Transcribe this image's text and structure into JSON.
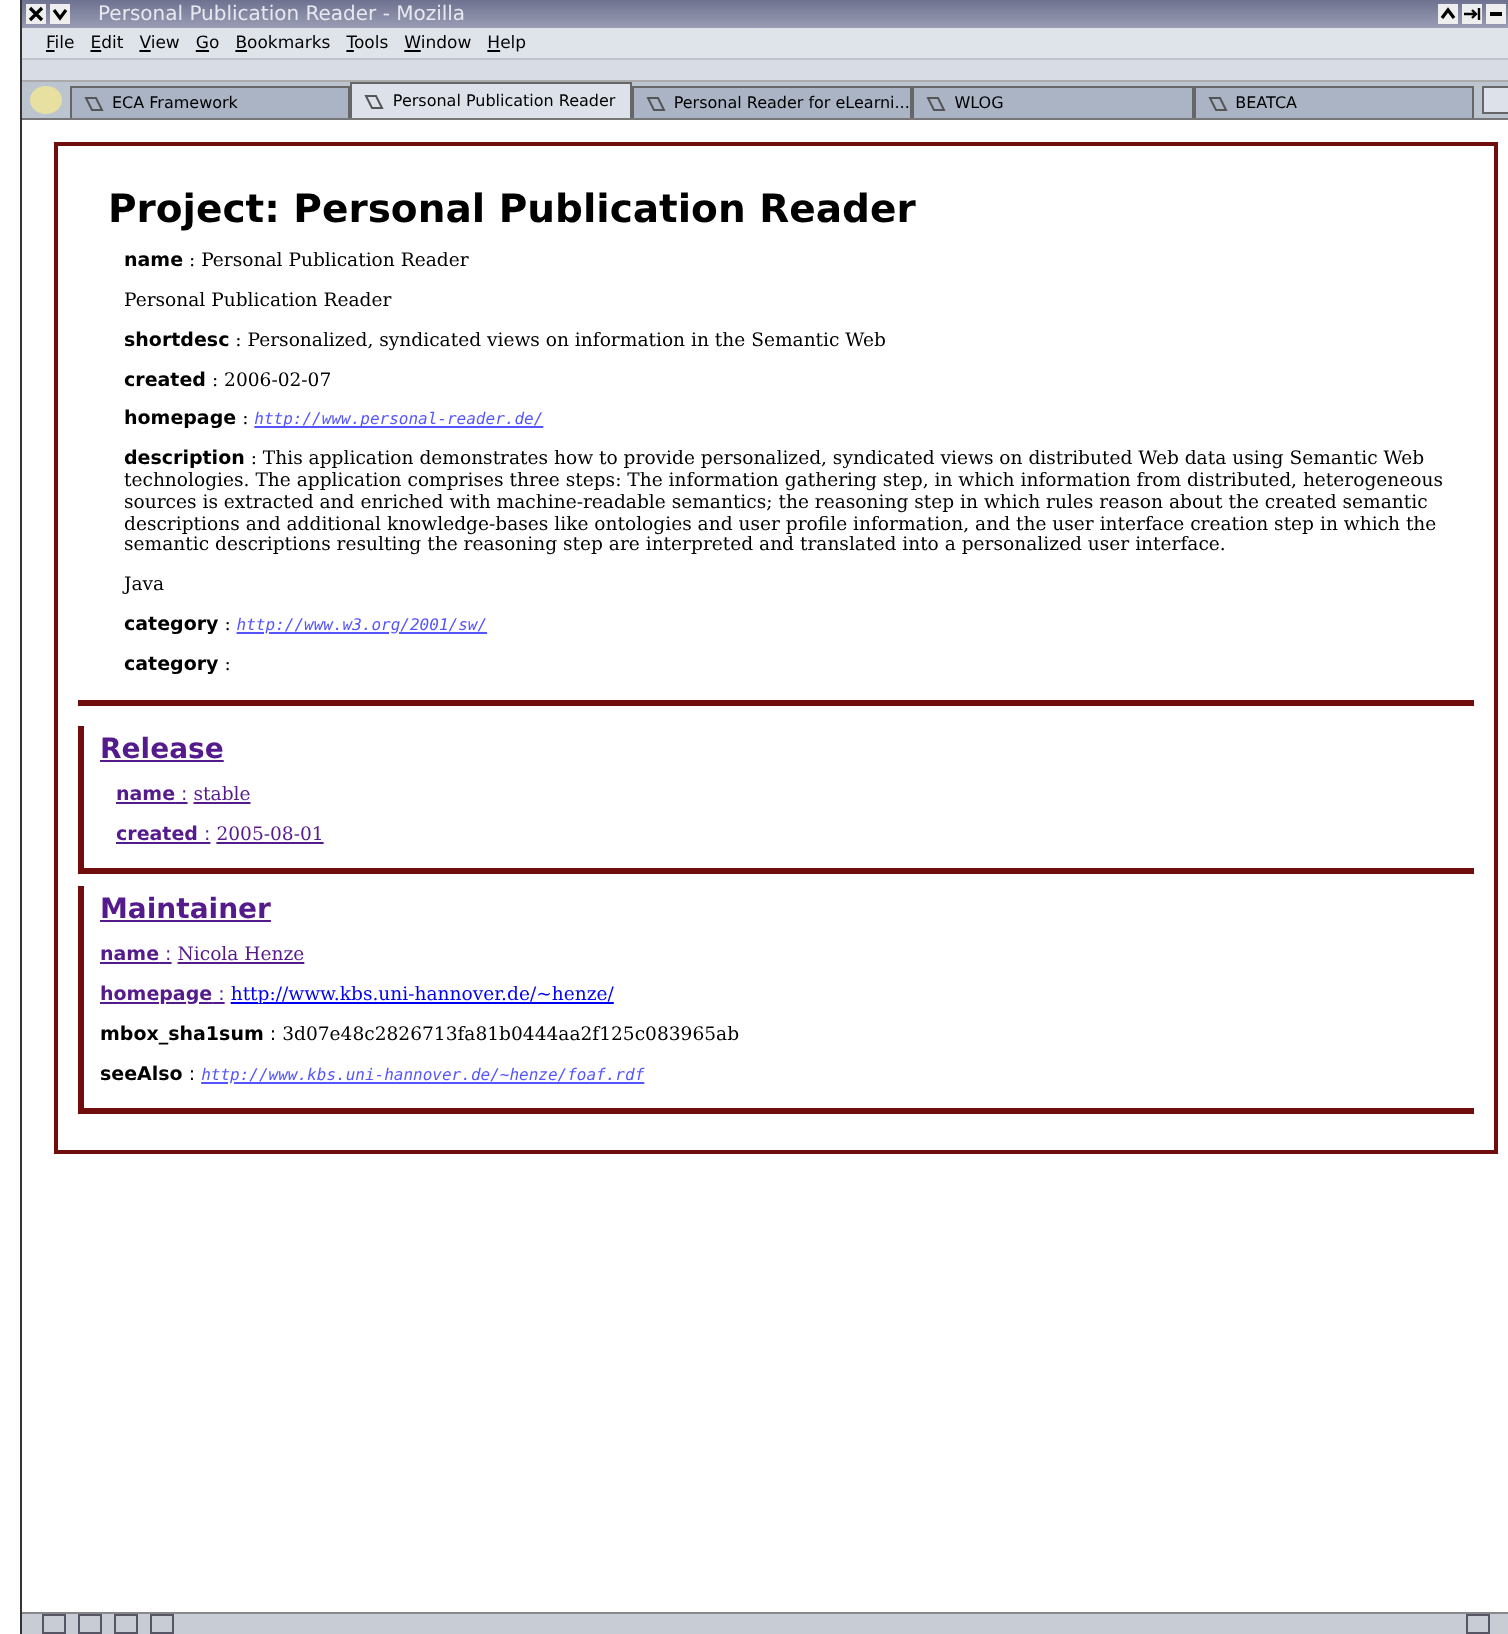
{
  "window": {
    "title": "Personal Publication Reader - Mozilla"
  },
  "menu": [
    "File",
    "Edit",
    "View",
    "Go",
    "Bookmarks",
    "Tools",
    "Window",
    "Help"
  ],
  "tabs": [
    {
      "label": "ECA Framework",
      "selected": false
    },
    {
      "label": "Personal Publication Reader",
      "selected": true
    },
    {
      "label": "Personal Reader for eLearni...",
      "selected": false
    },
    {
      "label": "WLOG",
      "selected": false
    },
    {
      "label": "BEATCA",
      "selected": false
    }
  ],
  "project": {
    "title": "Project: Personal Publication Reader",
    "fields": [
      {
        "label": "name",
        "separator": ":",
        "value": "Personal Publication Reader",
        "kind": "text"
      },
      {
        "value": "Personal Publication Reader",
        "kind": "text"
      },
      {
        "label": "shortdesc",
        "separator": ":",
        "value": "Personalized, syndicated views on information in the Semantic Web",
        "kind": "text"
      },
      {
        "label": "created",
        "separator": ":",
        "value": "2006-02-07",
        "kind": "text"
      },
      {
        "label": "homepage",
        "separator": ":",
        "value": "http://www.personal-reader.de/",
        "kind": "url"
      },
      {
        "label": "description",
        "separator": ":",
        "value": "This application demonstrates how to provide personalized, syndicated views on distributed Web data using Semantic Web technologies. The application comprises three steps: The information gathering step, in which information from distributed, heterogeneous sources is extracted and enriched with machine-readable semantics; the reasoning step in which rules reason about the created semantic descriptions and additional knowledge-bases like ontologies and user profile information, and the user interface creation step in which the semantic descriptions resulting the reasoning step are interpreted and translated into a personalized user interface.",
        "kind": "text"
      },
      {
        "value": "Java",
        "kind": "text"
      },
      {
        "label": "category",
        "separator": ":",
        "value": "http://www.w3.org/2001/sw/",
        "kind": "url"
      },
      {
        "label": "category",
        "separator": ":"
      }
    ]
  },
  "sections": [
    {
      "heading": "Release",
      "indented": true,
      "fields": [
        {
          "label": "name",
          "separator": ":",
          "value": "stable",
          "kind": "visited",
          "label_link": true
        },
        {
          "label": "created",
          "separator": ":",
          "value": "2005-08-01",
          "kind": "visited",
          "label_link": true
        }
      ]
    },
    {
      "heading": "Maintainer",
      "indented": false,
      "fields": [
        {
          "label": "name",
          "separator": ":",
          "value": "Nicola Henze",
          "kind": "visited",
          "label_link": true
        },
        {
          "label": "homepage",
          "separator": ":",
          "value": "http://www.kbs.uni-hannover.de/~henze/",
          "kind": "link",
          "label_link": true
        },
        {
          "label": "mbox_sha1sum",
          "separator": ":",
          "value": "3d07e48c2826713fa81b0444aa2f125c083965ab",
          "kind": "text",
          "label_link": false
        },
        {
          "label": "seeAlso",
          "separator": ":",
          "value": "http://www.kbs.uni-hannover.de/~henze/foaf.rdf",
          "kind": "url",
          "label_link": false
        }
      ]
    }
  ]
}
